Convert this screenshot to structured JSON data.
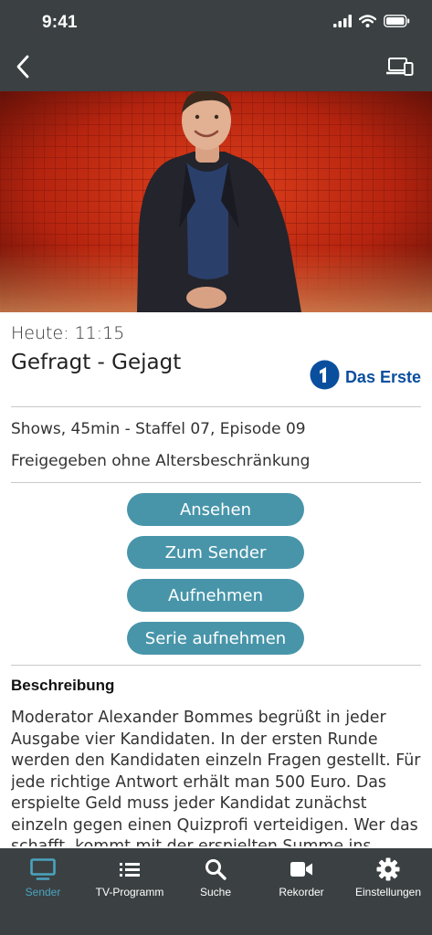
{
  "status_bar": {
    "time": "9:41"
  },
  "program": {
    "air_time": "Heute: 11:15",
    "title": "Gefragt - Gejagt",
    "channel": "Das Erste",
    "channel_logo_number": "1",
    "details": "Shows, 45min - Staffel 07, Episode 09",
    "rating": "Freigegeben ohne Altersbeschränkung"
  },
  "actions": {
    "watch": "Ansehen",
    "to_channel": "Zum Sender",
    "record": "Aufnehmen",
    "record_series": "Serie aufnehmen"
  },
  "description": {
    "heading": "Beschreibung",
    "text": "Moderator Alexander Bommes begrüßt in jeder Ausgabe vier Kandidaten. In der ersten Runde werden den Kandidaten einzeln Fragen gestellt. Für jede richtige Antwort erhält man 500 Euro. Das erspielte Geld muss jeder Kandidat zunächst einzeln gegen einen Quizprofi verteidigen. Wer das schafft, kommt mit der erspielten Summe ins Finale. Die"
  },
  "tab_bar": {
    "tabs": [
      {
        "label": "Sender",
        "icon": "tv-icon",
        "active": true
      },
      {
        "label": "TV-Programm",
        "icon": "list-icon",
        "active": false
      },
      {
        "label": "Suche",
        "icon": "search-icon",
        "active": false
      },
      {
        "label": "Rekorder",
        "icon": "video-camera-icon",
        "active": false
      },
      {
        "label": "Einstellungen",
        "icon": "gear-icon",
        "active": false
      }
    ]
  },
  "colors": {
    "bar_background": "#3b4143",
    "button": "#4895aa",
    "active_tab": "#4aa3c0",
    "channel_brand": "#0a4f9e"
  }
}
